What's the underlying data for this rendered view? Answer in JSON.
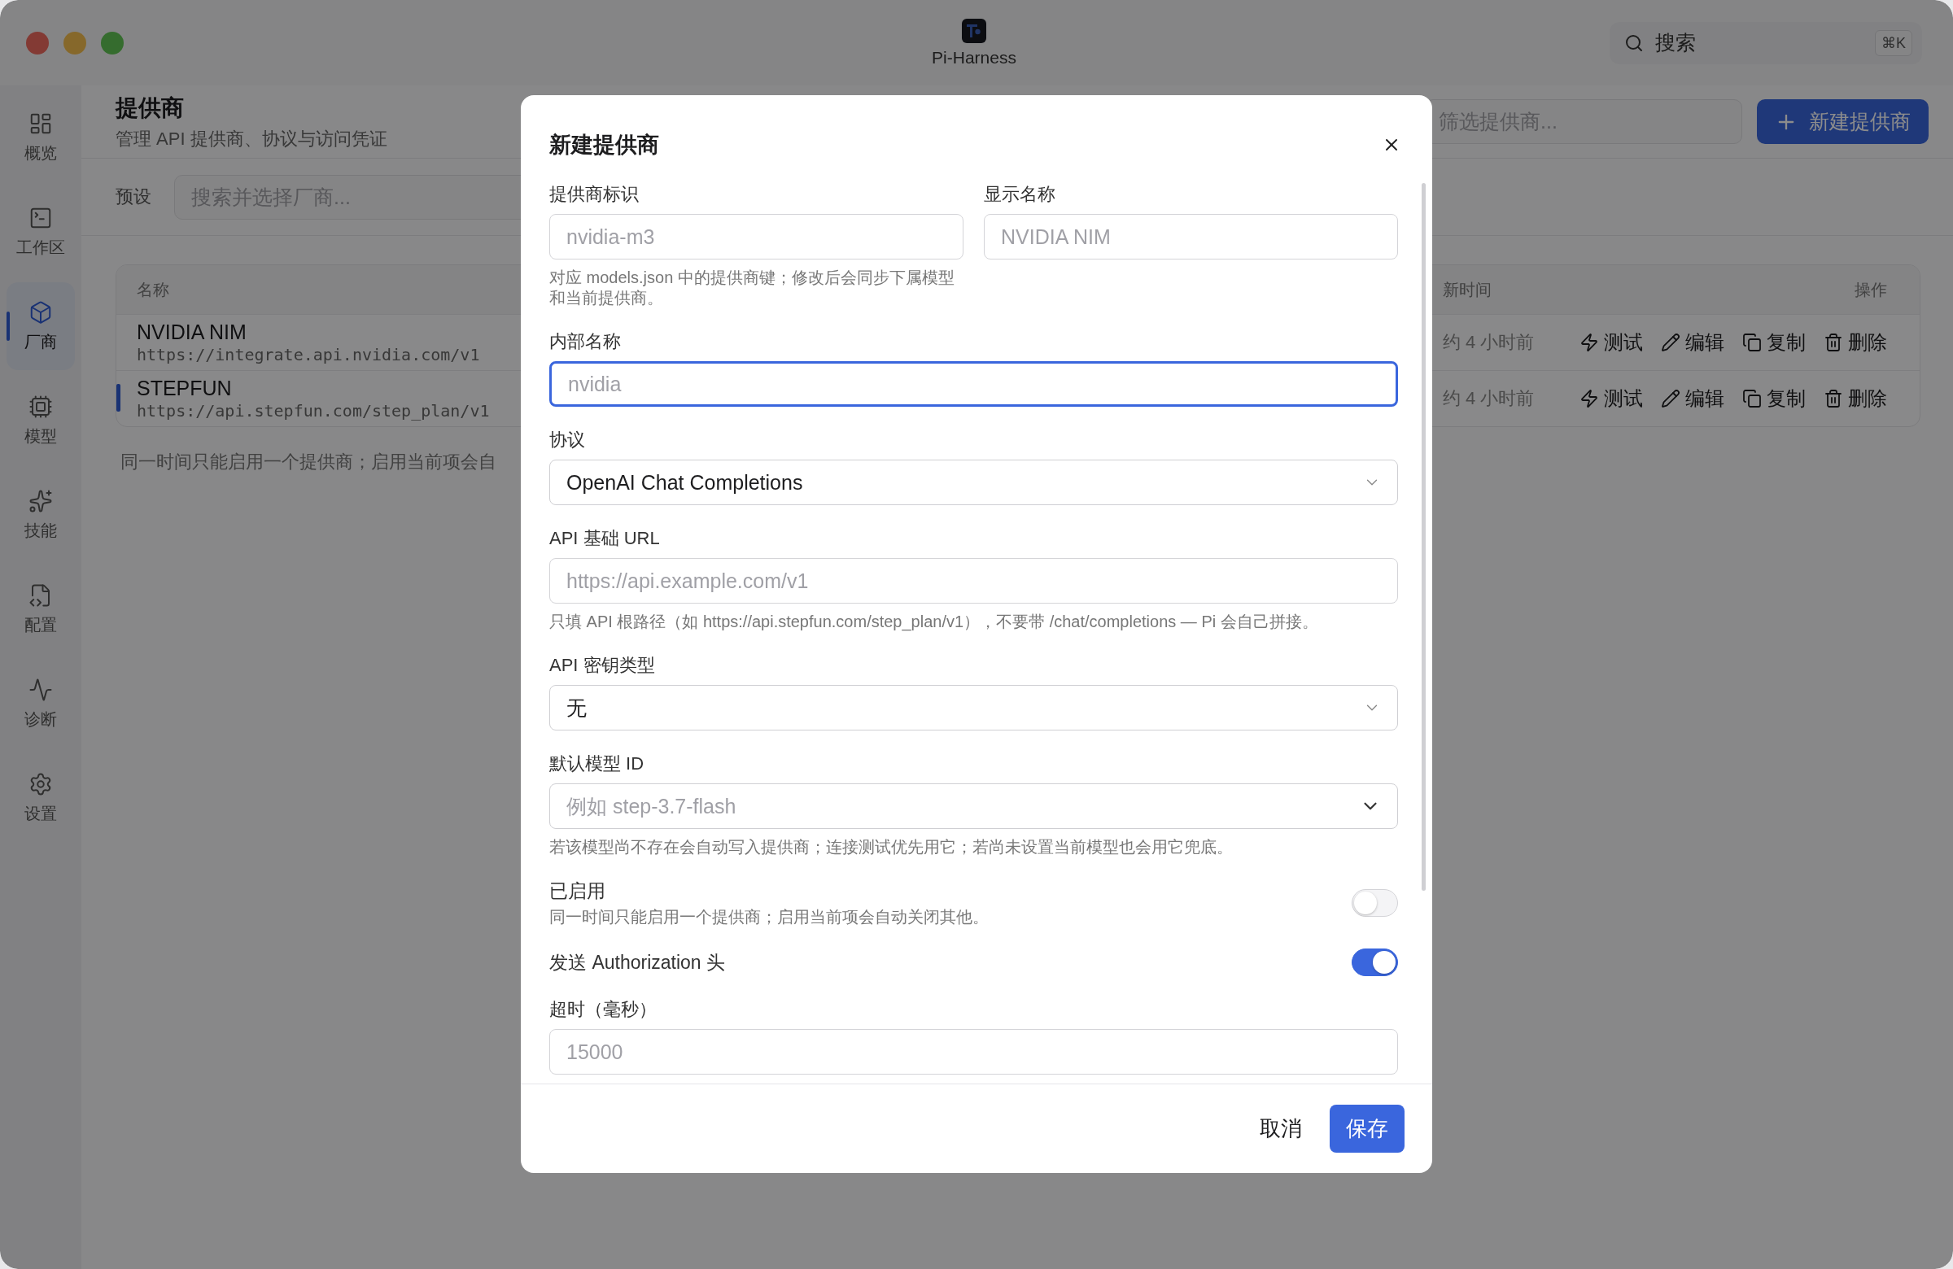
{
  "window": {
    "title": "Pi-Harness"
  },
  "search": {
    "placeholder": "搜索",
    "shortcut": "⌘K"
  },
  "sidebar": {
    "items": [
      {
        "label": "概览",
        "selected": false
      },
      {
        "label": "工作区",
        "selected": false
      },
      {
        "label": "厂商",
        "selected": true
      },
      {
        "label": "模型",
        "selected": false
      },
      {
        "label": "技能",
        "selected": false
      },
      {
        "label": "配置",
        "selected": false
      },
      {
        "label": "诊断",
        "selected": false
      },
      {
        "label": "设置",
        "selected": false
      }
    ]
  },
  "page": {
    "title": "提供商",
    "subtitle": "管理 API 提供商、协议与访问凭证",
    "filter": {
      "placeholder": "筛选提供商..."
    },
    "new_button": "新建提供商"
  },
  "preset": {
    "label": "预设",
    "placeholder": "搜索并选择厂商..."
  },
  "table": {
    "columns": [
      "名称",
      "新时间",
      "操作"
    ],
    "rows": [
      {
        "name": "NVIDIA NIM",
        "url": "https://integrate.api.nvidia.com/v1",
        "updated": "约 4 小时前",
        "active": false,
        "actions": [
          "测试",
          "编辑",
          "复制",
          "删除"
        ]
      },
      {
        "name": "STEPFUN",
        "url": "https://api.stepfun.com/step_plan/v1",
        "updated": "约 4 小时前",
        "active": true,
        "actions": [
          "测试",
          "编辑",
          "复制",
          "删除"
        ]
      }
    ]
  },
  "note": "同一时间只能启用一个提供商；启用当前项会自",
  "dialog": {
    "title": "新建提供商",
    "fields": [
      {
        "kind": "pair",
        "fields": [
          {
            "label": "提供商标识",
            "placeholder": "nvidia-m3",
            "hint": "对应 models.json 中的提供商键；修改后会同步下属模型和当前提供商。"
          },
          {
            "label": "显示名称",
            "placeholder": "NVIDIA NIM"
          }
        ]
      },
      {
        "kind": "text",
        "label": "内部名称",
        "placeholder": "nvidia",
        "focused": true
      },
      {
        "kind": "select",
        "label": "协议",
        "value": "OpenAI Chat Completions"
      },
      {
        "kind": "text",
        "label": "API 基础 URL",
        "placeholder": "https://api.example.com/v1",
        "focused": false,
        "hint": "只填 API 根路径（如 https://api.stepfun.com/step_plan/v1），不要带 /chat/completions — Pi 会自己拼接。"
      },
      {
        "kind": "select",
        "label": "API 密钥类型",
        "value": "无"
      },
      {
        "kind": "combobox",
        "label": "默认模型 ID",
        "placeholder": "例如 step-3.7-flash",
        "hint": "若该模型尚不存在会自动写入提供商；连接测试优先用它；若尚未设置当前模型也会用它兜底。"
      },
      {
        "kind": "toggle",
        "label": "已启用",
        "description": "同一时间只能启用一个提供商；启用当前项会自动关闭其他。",
        "on": false
      },
      {
        "kind": "toggle",
        "label": "发送 Authorization 头",
        "on": true
      },
      {
        "kind": "text",
        "label": "超时（毫秒）",
        "placeholder": "15000",
        "focused": false
      }
    ],
    "buttons": {
      "cancel": "取消",
      "save": "保存"
    }
  }
}
